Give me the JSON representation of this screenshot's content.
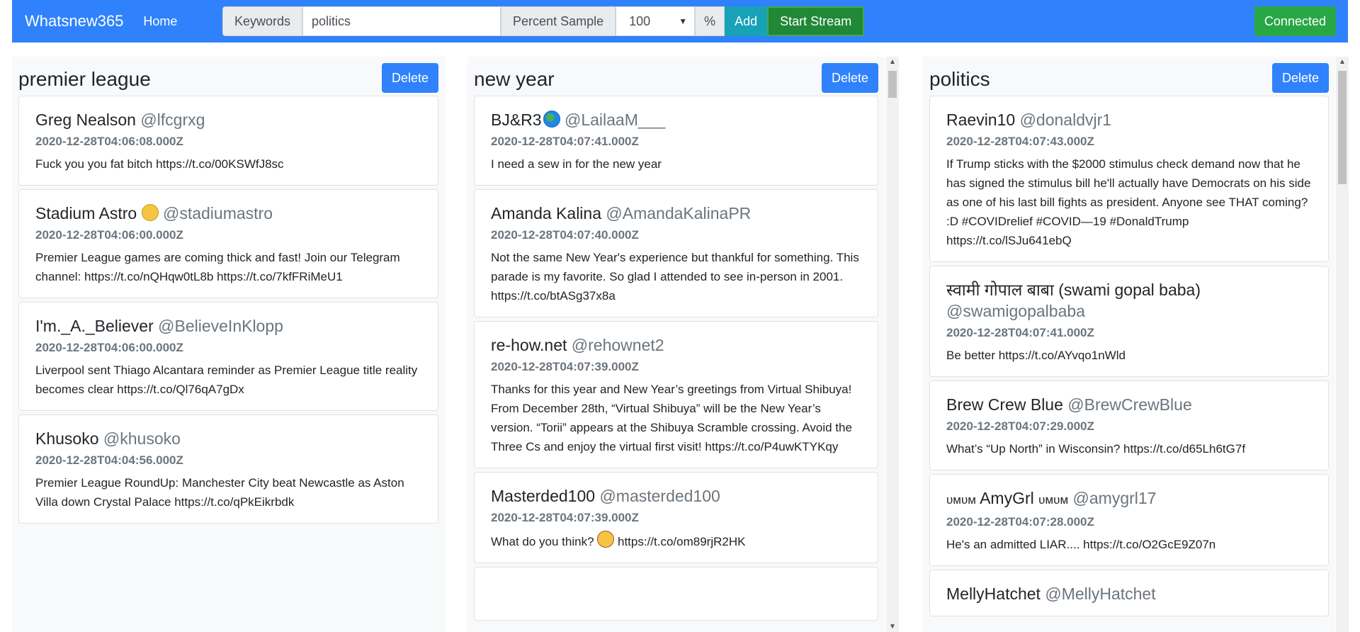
{
  "nav": {
    "brand": "Whatsnew365",
    "home": "Home",
    "keywords_label": "Keywords",
    "keywords_value": "politics",
    "percent_label": "Percent Sample",
    "percent_value": "100",
    "percent_unit": "%",
    "add": "Add",
    "start": "Start Stream",
    "status": "Connected"
  },
  "columns": [
    {
      "title": "premier league",
      "delete": "Delete",
      "tweets": [
        {
          "name": "Greg Nealson",
          "handle": "@lfcgrxg",
          "time": "2020-12-28T04:06:08.000Z",
          "text": "Fuck you you fat bitch https://t.co/00KSWfJ8sc"
        },
        {
          "name": "Stadium Astro",
          "emoji": "sunglasses-emoji",
          "handle": "@stadiumastro",
          "time": "2020-12-28T04:06:00.000Z",
          "text": "Premier League games are coming thick and fast! Join our Telegram channel: https://t.co/nQHqw0tL8b https://t.co/7kfFRiMeU1"
        },
        {
          "name": "I'm._A._Believer",
          "handle": "@BelieveInKlopp",
          "time": "2020-12-28T04:06:00.000Z",
          "text": "Liverpool sent Thiago Alcantara reminder as Premier League title reality becomes clear https://t.co/Ql76qA7gDx"
        },
        {
          "name": "Khusoko",
          "handle": "@khusoko",
          "time": "2020-12-28T04:04:56.000Z",
          "text": "Premier League RoundUp: Manchester City beat Newcastle as Aston Villa down Crystal Palace https://t.co/qPkEikrbdk"
        }
      ]
    },
    {
      "title": "new year",
      "delete": "Delete",
      "tweets": [
        {
          "name": "BJ&R3",
          "emoji": "globe-emoji",
          "handle": "@LailaaM___",
          "time": "2020-12-28T04:07:41.000Z",
          "text": "I need a sew in for the new year"
        },
        {
          "name": "Amanda Kalina",
          "handle": "@AmandaKalinaPR",
          "time": "2020-12-28T04:07:40.000Z",
          "text": "Not the same New Year's experience but thankful for something. This parade is my favorite. So glad I attended to see in-person in 2001. https://t.co/btASg37x8a"
        },
        {
          "name": "re-how.net",
          "handle": "@rehownet2",
          "time": "2020-12-28T04:07:39.000Z",
          "text": "Thanks for this year and New Year’s greetings from Virtual Shibuya! From December 28th, “Virtual Shibuya” will be the New Year’s version. “Torii” appears at the Shibuya Scramble crossing. Avoid the Three Cs and enjoy the virtual first visit! https://t.co/P4uwKTYKqy"
        },
        {
          "name": "Masterded100",
          "handle": "@masterded100",
          "time": "2020-12-28T04:07:39.000Z",
          "text_before": "What do you think? ",
          "text_after": " https://t.co/om89rjR2HK",
          "emoji": "cowboy-emoji"
        }
      ]
    },
    {
      "title": "politics",
      "delete": "Delete",
      "tweets": [
        {
          "name": "Raevin10",
          "handle": "@donaldvjr1",
          "time": "2020-12-28T04:07:43.000Z",
          "text": "If Trump sticks with the $2000 stimulus check demand now that he has signed the stimulus bill he'll actually have Democrats on his side as one of his last bill fights as president. Anyone see THAT coming? :D #COVIDrelief #COVID—19 #DonaldTrump https://t.co/lSJu641ebQ"
        },
        {
          "name": "स्वामी गोपाल बाबा (swami gopal baba)",
          "handle": "@swamigopalbaba",
          "time": "2020-12-28T04:07:41.000Z",
          "text": "Be better https://t.co/AYvqo1nWld"
        },
        {
          "name": "Brew Crew Blue",
          "handle": "@BrewCrewBlue",
          "time": "2020-12-28T04:07:29.000Z",
          "text": "What’s “Up North” in Wisconsin? https://t.co/d65Lh6tG7f"
        },
        {
          "name_pre": "ᴜᴍᴜᴍ",
          "name": "AmyGrl",
          "name_post": "ᴜᴍᴜᴍ",
          "handle": "@amygrl17",
          "time": "2020-12-28T04:07:28.000Z",
          "text": "He's an admitted LIAR.... https://t.co/O2GcE9Z07n"
        },
        {
          "name": "MellyHatchet",
          "handle": "@MellyHatchet"
        }
      ]
    }
  ]
}
